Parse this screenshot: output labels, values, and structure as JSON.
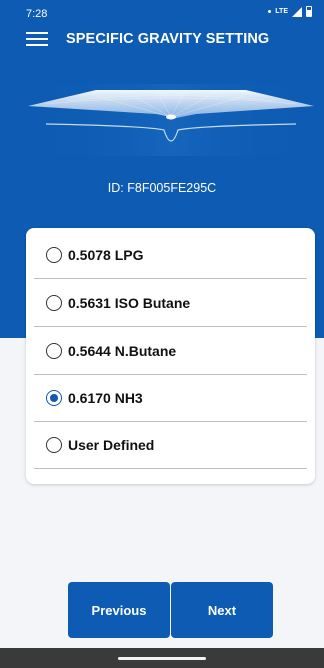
{
  "status_bar": {
    "time": "7:28",
    "network": "LTE",
    "icons": [
      "notification-dot-icon",
      "signal-icon",
      "battery-icon"
    ]
  },
  "app_bar": {
    "title": "SPECIFIC GRAVITY SETTING",
    "menu_icon": "hamburger-menu-icon"
  },
  "device": {
    "id_text": "ID: F8F005FE295C"
  },
  "options": {
    "items": [
      {
        "label": "0.5078 LPG",
        "selected": false
      },
      {
        "label": "0.5631 ISO Butane",
        "selected": false
      },
      {
        "label": "0.5644 N.Butane",
        "selected": false
      },
      {
        "label": "0.6170 NH3",
        "selected": true
      },
      {
        "label": "User Defined",
        "selected": false
      }
    ]
  },
  "buttons": {
    "previous": "Previous",
    "next": "Next"
  },
  "colors": {
    "primary": "#0d5bb3",
    "background": "#f4f5f9",
    "card": "#ffffff",
    "navbar": "#3a3a3a"
  }
}
